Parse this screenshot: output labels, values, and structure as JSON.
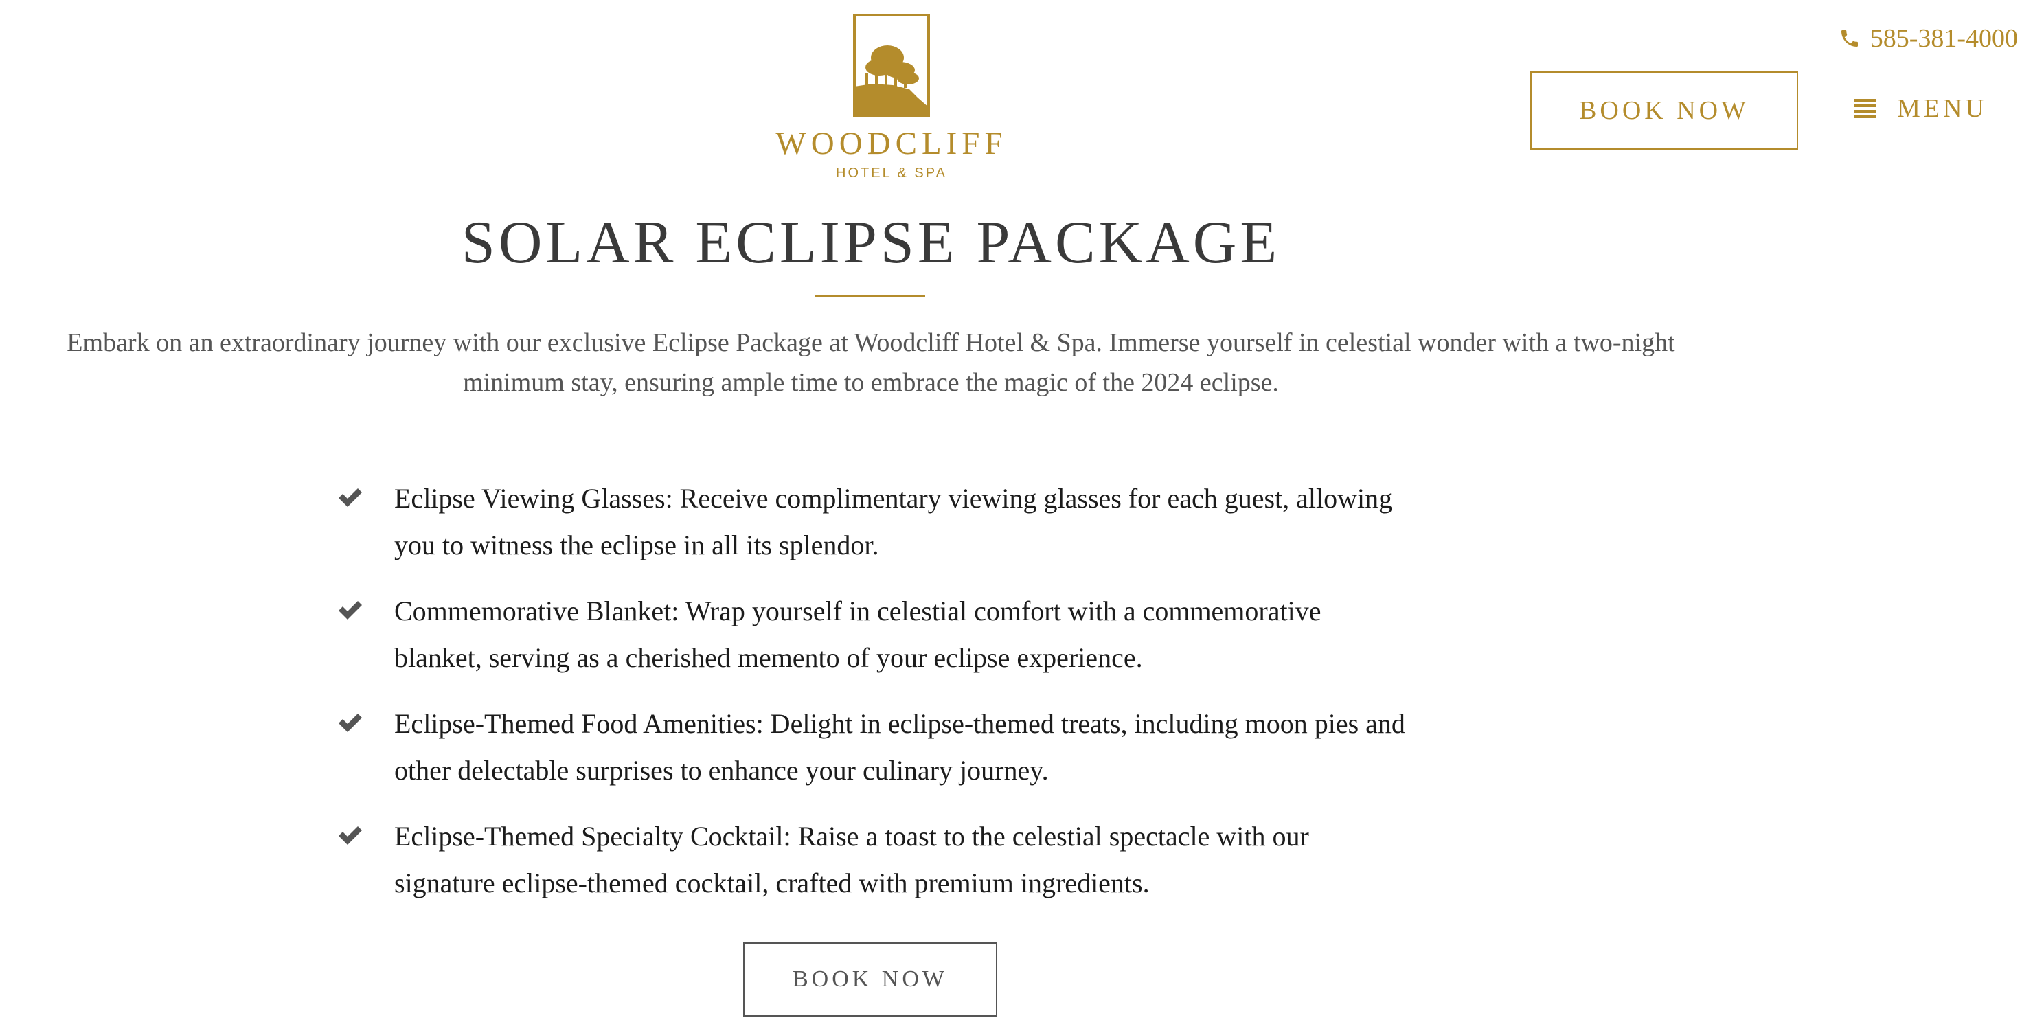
{
  "header": {
    "logo": {
      "name": "WOODCLIFF",
      "tagline": "HOTEL & SPA"
    },
    "phone": "585-381-4000",
    "book_label": "BOOK NOW",
    "menu_label": "MENU"
  },
  "main": {
    "title": "SOLAR ECLIPSE PACKAGE",
    "intro": "Embark on an extraordinary journey with our exclusive Eclipse Package at Woodcliff Hotel & Spa. Immerse yourself in celestial wonder with a two-night minimum stay, ensuring ample time to embrace the magic of the 2024 eclipse.",
    "features": [
      "Eclipse Viewing Glasses: Receive complimentary viewing glasses for each guest, allowing you to witness the eclipse in all its splendor.",
      "Commemorative Blanket: Wrap yourself in celestial comfort with a commemorative blanket, serving as a cherished memento of your eclipse experience.",
      "Eclipse-Themed Food Amenities: Delight in eclipse-themed treats, including moon pies and other delectable surprises to enhance your culinary journey.",
      "Eclipse-Themed Specialty Cocktail: Raise a toast to the celestial spectacle with our signature eclipse-themed cocktail, crafted with premium ingredients."
    ],
    "book_label": "BOOK NOW"
  },
  "colors": {
    "accent": "#b48c2c",
    "text": "#2f2f2f",
    "muted": "#555555",
    "background": "#ffffff"
  },
  "icons": {
    "phone": "phone-icon",
    "menu": "menu-icon",
    "check": "check-icon",
    "logo": "tree-logo-icon"
  }
}
